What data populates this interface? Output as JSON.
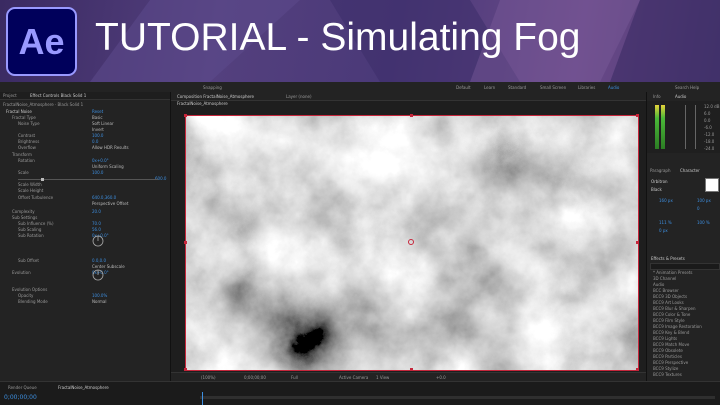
{
  "banner": {
    "logo_text": "Ae",
    "title": "TUTORIAL - Simulating Fog"
  },
  "colors": {
    "accent_blue": "#3d8fe0",
    "selection_red": "#c6263b",
    "ae_logo_bg": "#00005b",
    "ae_logo_fg": "#9999ff"
  },
  "workspaces": [
    "Default",
    "Learn",
    "Standard",
    "Small Screen",
    "Libraries",
    "Audio"
  ],
  "workspace_active": "Audio",
  "snapping_label": "Snapping",
  "search_help": "Search Help",
  "left_panel": {
    "tabs": [
      "Project",
      "Effect Controls Black Solid 1"
    ],
    "layer_path": "FractalNoise_Atmosphere · Black Solid 1",
    "effect_name": "Fractal Noise",
    "reset": "Reset",
    "properties": [
      {
        "label": "Fractal Type",
        "value": "Basic"
      },
      {
        "label": "Noise Type",
        "value": "Soft Linear"
      },
      {
        "label": "",
        "value": "Invert"
      },
      {
        "label": "Contrast",
        "value": "100.0"
      },
      {
        "label": "Brightness",
        "value": "0.0"
      },
      {
        "label": "Overflow",
        "value": "Allow HDR Results"
      },
      {
        "label": "Transform",
        "value": ""
      },
      {
        "label": "Rotation",
        "value": "0x+0.0°"
      },
      {
        "label": "",
        "value": "Uniform Scaling"
      },
      {
        "label": "Scale",
        "value": "100.0"
      },
      {
        "label": "",
        "value": "600.0"
      },
      {
        "label": "Scale Width",
        "value": ""
      },
      {
        "label": "Scale Height",
        "value": ""
      },
      {
        "label": "Offset Turbulence",
        "value": "640.0,360.0"
      },
      {
        "label": "",
        "value": "Perspective Offset"
      },
      {
        "label": "Complexity",
        "value": "20.0"
      },
      {
        "label": "Sub Settings",
        "value": ""
      },
      {
        "label": "Sub Influence (%)",
        "value": "70.0"
      },
      {
        "label": "Sub Scaling",
        "value": "56.0"
      },
      {
        "label": "Sub Rotation",
        "value": "0x+0.0°"
      },
      {
        "label": "Sub Offset",
        "value": "0.0,0.0"
      },
      {
        "label": "",
        "value": "Center Subscale"
      },
      {
        "label": "Evolution",
        "value": "0x+0.0°"
      },
      {
        "label": "Evolution Options",
        "value": ""
      },
      {
        "label": "Opacity",
        "value": "100.0%"
      },
      {
        "label": "Blending Mode",
        "value": "Normal"
      }
    ]
  },
  "viewer": {
    "tabs": [
      "Composition FractalNoise_Atmosphere",
      "Layer (none)"
    ],
    "sub_tab": "FractalNoise_Atmosphere",
    "zoom": "(100%)",
    "timecode": "0;00;00;00",
    "resolution": "Full",
    "camera": "Active Camera",
    "views": "1 View",
    "exposure": "+0.0"
  },
  "right_panel": {
    "info_tabs": [
      "Info",
      "Audio"
    ],
    "db_scale": [
      "12.0 dB",
      "6.0",
      "0.0",
      "-6.0",
      "-12.0",
      "-18.0",
      "-24.0"
    ],
    "text_tabs": [
      "Paragraph",
      "Character"
    ],
    "font_name": "Orbitron",
    "font_style": "Black",
    "font_size": "160 px",
    "leading": "100 px",
    "tracking": "0",
    "scale_v": "111 %",
    "scale_h": "100 %",
    "baseline": "0 px",
    "effects_title": "Effects & Presets",
    "effects_list": [
      "* Animation Presets",
      "3D Channel",
      "Audio",
      "BCC Browser",
      "BCC9 3D Objects",
      "BCC9 Art Looks",
      "BCC9 Blur & Sharpen",
      "BCC9 Color & Tone",
      "BCC9 Film Style",
      "BCC9 Image Restoration",
      "BCC9 Key & Blend",
      "BCC9 Lights",
      "BCC9 Match Move",
      "BCC9 Obsolete",
      "BCC9 Particles",
      "BCC9 Perspective",
      "BCC9 Stylize",
      "BCC9 Textures"
    ]
  },
  "timeline": {
    "tabs": [
      "Render Queue",
      "FractalNoise_Atmosphere"
    ],
    "timecode": "0;00;00;00"
  }
}
